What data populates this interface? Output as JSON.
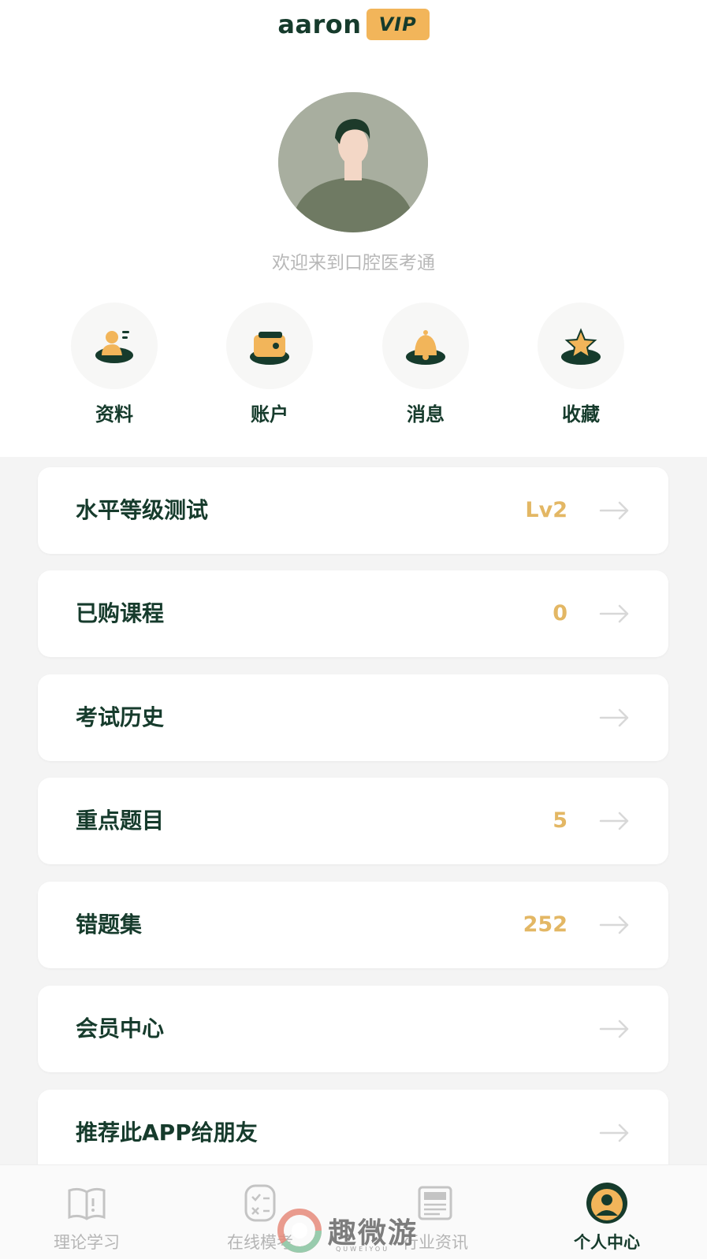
{
  "header": {
    "username": "aaron",
    "vip_label": "VIP"
  },
  "welcome_text": "欢迎来到口腔医考通",
  "colors": {
    "primary": "#163b2c",
    "accent": "#f2b55a",
    "value": "#e3b764"
  },
  "quick_actions": [
    {
      "label": "资料",
      "icon": "profile-icon"
    },
    {
      "label": "账户",
      "icon": "wallet-icon"
    },
    {
      "label": "消息",
      "icon": "bell-icon"
    },
    {
      "label": "收藏",
      "icon": "star-icon"
    }
  ],
  "menu": [
    {
      "label": "水平等级测试",
      "value": "Lv2"
    },
    {
      "label": "已购课程",
      "value": "0"
    },
    {
      "label": "考试历史",
      "value": ""
    },
    {
      "label": "重点题目",
      "value": "5"
    },
    {
      "label": "错题集",
      "value": "252"
    },
    {
      "label": "会员中心",
      "value": ""
    },
    {
      "label": "推荐此APP给朋友",
      "value": ""
    }
  ],
  "tabbar": [
    {
      "label": "理论学习",
      "icon": "book-icon",
      "active": false
    },
    {
      "label": "在线模考",
      "icon": "exam-icon",
      "active": false
    },
    {
      "label": "行业资讯",
      "icon": "news-icon",
      "active": false
    },
    {
      "label": "个人中心",
      "icon": "user-icon",
      "active": true
    }
  ],
  "watermark": {
    "text": "趣微游",
    "sub": "QUWEIYOU"
  }
}
